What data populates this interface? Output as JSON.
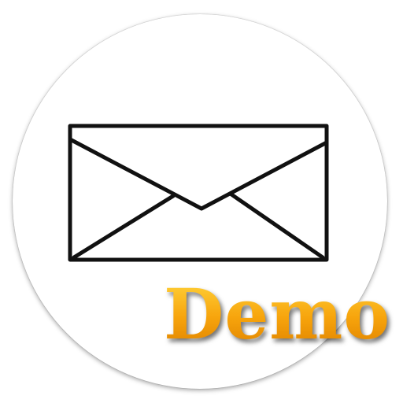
{
  "app_icon": {
    "icon": "envelope-icon",
    "badge_text": "Demo",
    "colors": {
      "background": "#ffffff",
      "envelope_stroke": "#111111",
      "badge_light": "#ffd23a",
      "badge_dark": "#e08400"
    }
  }
}
